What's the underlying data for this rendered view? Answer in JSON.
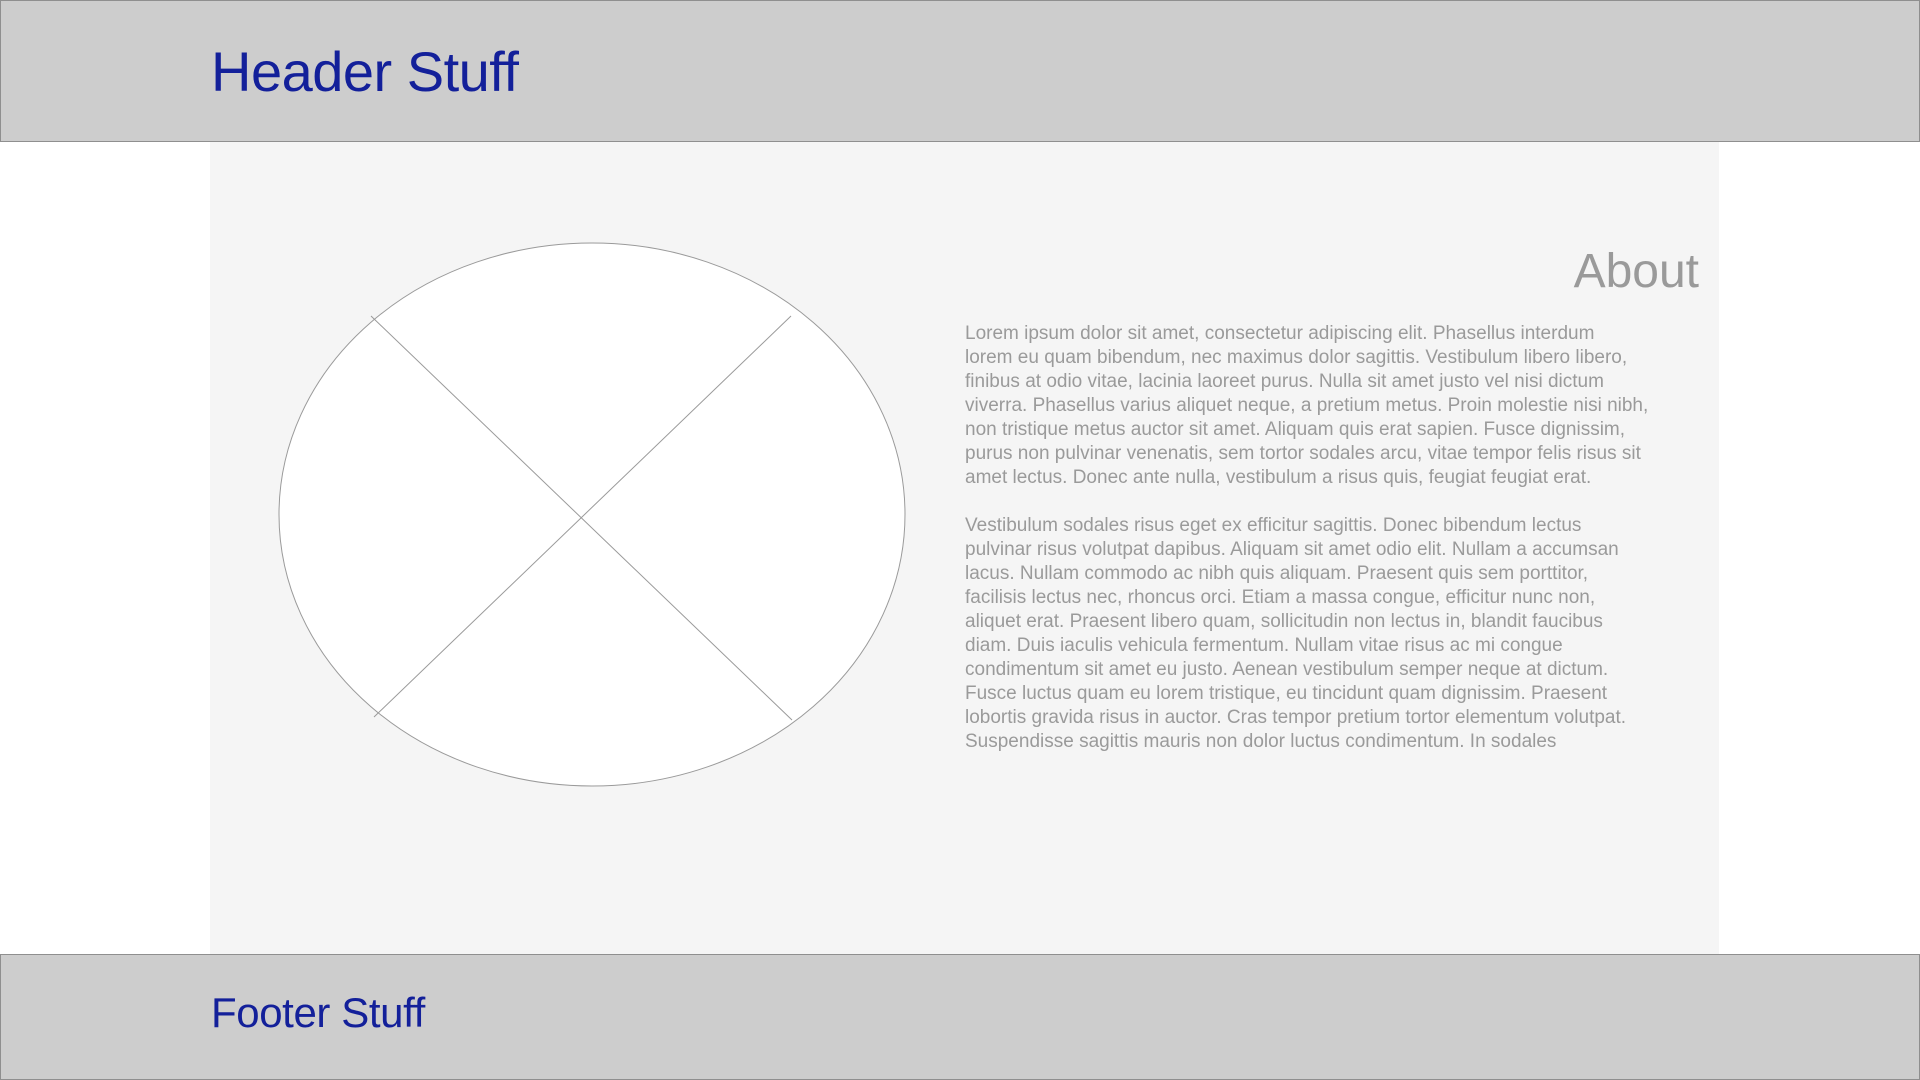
{
  "header": {
    "title": "Header Stuff"
  },
  "main": {
    "image": {
      "icon": "image-placeholder-icon"
    },
    "about": {
      "title": "About",
      "paragraphs": [
        "Lorem ipsum dolor sit amet, consectetur adipiscing elit. Phasellus interdum\nlorem eu quam bibendum, nec maximus dolor sagittis. Vestibulum libero libero,\nfinibus at odio vitae, lacinia laoreet purus. Nulla sit amet justo vel nisi dictum\nviverra. Phasellus varius aliquet neque, a pretium metus. Proin molestie nisi nibh,\nnon tristique metus auctor sit amet. Aliquam quis erat sapien. Fusce dignissim,\npurus non pulvinar venenatis, sem tortor sodales arcu, vitae tempor felis risus sit\namet lectus. Donec ante nulla, vestibulum a risus quis, feugiat feugiat erat.",
        "Vestibulum sodales risus eget ex efficitur sagittis. Donec bibendum lectus\npulvinar risus volutpat dapibus. Aliquam sit amet odio elit. Nullam a accumsan\nlacus. Nullam commodo ac nibh quis aliquam. Praesent quis sem porttitor,\nfacilisis lectus nec, rhoncus orci. Etiam a massa congue, efficitur nunc non,\naliquet erat. Praesent libero quam, sollicitudin non lectus in, blandit faucibus\ndiam. Duis iaculis vehicula fermentum. Nullam vitae risus ac mi congue\ncondimentum sit amet eu justo. Aenean vestibulum semper neque at dictum.\nFusce luctus quam eu lorem tristique, eu tincidunt quam dignissim. Praesent\nlobortis gravida risus in auctor. Cras tempor pretium tortor elementum volutpat.\nSuspendisse sagittis mauris non dolor luctus condimentum. In sodales"
      ]
    }
  },
  "footer": {
    "title": "Footer Stuff"
  },
  "colors": {
    "header_bg": "#cdcdcd",
    "title_text": "#13209a",
    "main_bg": "#f5f5f5",
    "body_text": "#9a9a9a"
  }
}
